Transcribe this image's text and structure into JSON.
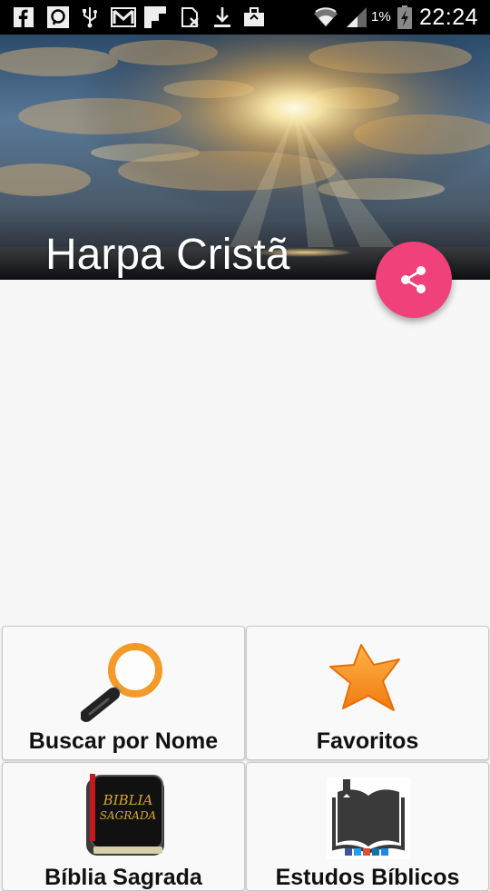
{
  "status_bar": {
    "battery_percent": "1%",
    "time": "22:24",
    "icons": [
      "facebook-icon",
      "messenger-icon",
      "usb-icon",
      "gmail-icon",
      "flipboard-icon",
      "no-sim-icon",
      "download-icon",
      "briefcase-icon",
      "wifi-icon",
      "signal-icon",
      "battery-charging-icon"
    ]
  },
  "header": {
    "title": "Harpa Cristã"
  },
  "fab": {
    "icon": "share-icon",
    "color": "#f0417b"
  },
  "menu": {
    "items": [
      {
        "label": "Buscar por Nome",
        "icon": "magnifier-icon"
      },
      {
        "label": "Favoritos",
        "icon": "star-icon"
      },
      {
        "label": "Bíblia Sagrada",
        "icon": "bible-icon"
      },
      {
        "label": "Estudos Bíblicos",
        "icon": "open-book-icon"
      }
    ]
  }
}
